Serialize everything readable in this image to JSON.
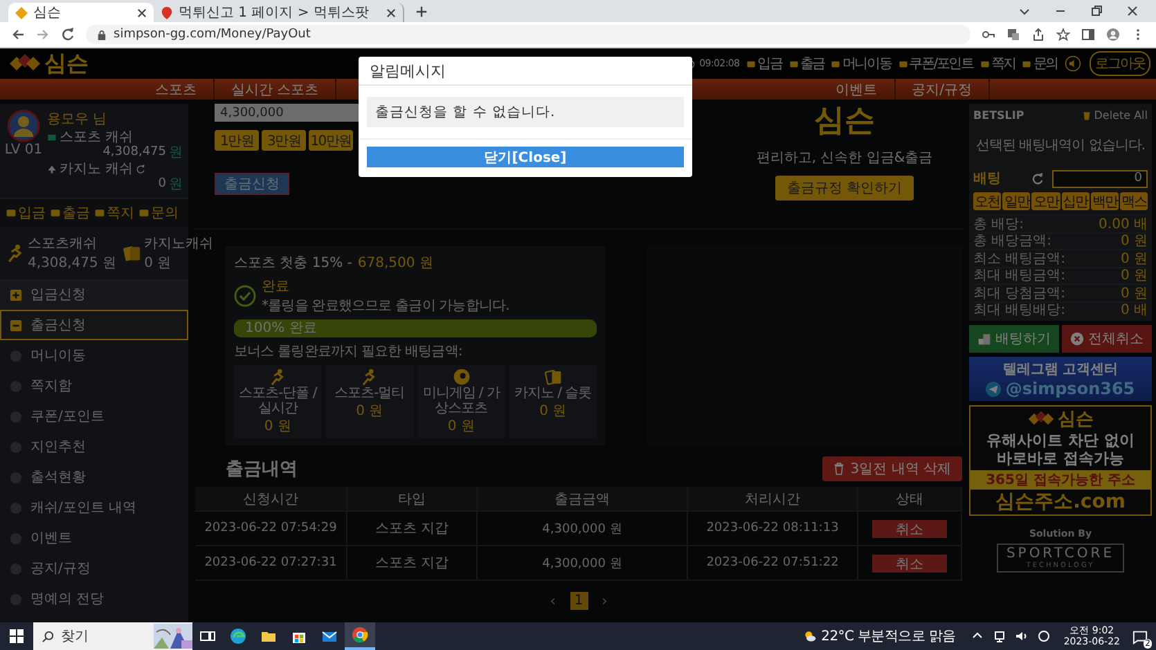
{
  "browser": {
    "tabs": [
      {
        "title": "심슨",
        "selected": true
      },
      {
        "title": "먹튀신고 1 페이지 > 먹튀스팟",
        "selected": false
      }
    ],
    "url": "simpson-gg.com/Money/PayOut"
  },
  "header": {
    "logo": "심슨",
    "clock": "09:02:08",
    "links": [
      "입금",
      "출금",
      "머니이동",
      "쿠폰/포인트",
      "쪽지",
      "문의"
    ],
    "logout": "로그아웃"
  },
  "nav": {
    "left": [
      "스포츠",
      "실시간 스포츠"
    ],
    "right": [
      "이벤트",
      "공지/규정"
    ]
  },
  "user": {
    "name": "용모우 님",
    "level": "LV 01",
    "wallets": [
      {
        "kind": "sports",
        "label": "스포츠 캐쉬",
        "amount": "4,308,475",
        "unit": "원"
      },
      {
        "kind": "casino",
        "label": "카지노 캐쉬",
        "amount": "0",
        "unit": "원"
      }
    ],
    "quick_links": [
      "입금",
      "출금",
      "쪽지",
      "문의"
    ]
  },
  "cash_cards": [
    {
      "kind": "sports",
      "label": "스포츠캐쉬",
      "amount": "4,308,475 원"
    },
    {
      "kind": "casino",
      "label": "카지노캐쉬",
      "amount": "0 원"
    }
  ],
  "menu": [
    {
      "label": "입금신청",
      "kind": "plus",
      "selected": false
    },
    {
      "label": "출금신청",
      "kind": "minus",
      "selected": true
    },
    {
      "label": "머니이동",
      "kind": "dot",
      "selected": false
    },
    {
      "label": "쪽지함",
      "kind": "dot",
      "selected": false
    },
    {
      "label": "쿠폰/포인트",
      "kind": "dot",
      "selected": false
    },
    {
      "label": "지인추천",
      "kind": "dot",
      "selected": false
    },
    {
      "label": "출석현황",
      "kind": "dot",
      "selected": false
    },
    {
      "label": "캐쉬/포인트 내역",
      "kind": "dot",
      "selected": false
    },
    {
      "label": "이벤트",
      "kind": "dot",
      "selected": false
    },
    {
      "label": "공지/규정",
      "kind": "dot",
      "selected": false
    },
    {
      "label": "명예의 전당",
      "kind": "dot",
      "selected": false
    }
  ],
  "withdraw": {
    "amount": "4,300,000",
    "quick_amounts": [
      "1만원",
      "3만원",
      "10만원"
    ],
    "submit": "출금신청"
  },
  "info": {
    "logo": "심슨",
    "tagline": "편리하고, 신속한 입금&출금",
    "rules_button": "출금규정 확인하기"
  },
  "bonus": {
    "title": "스포츠 첫충 15% -",
    "amount": "678,500 원",
    "status": "완료",
    "note": "*롤링을 완료했으므로 출금이 가능합니다.",
    "progress": {
      "level": 1,
      "label": "100% 완료"
    },
    "requirement": "보너스 롤링완료까지 필요한 배팅금액:",
    "targets": [
      {
        "kind": "runner",
        "label": "스포츠-단폴 / 실시간",
        "amount": "0 원"
      },
      {
        "kind": "runner",
        "label": "스포츠-멀티",
        "amount": "0 원"
      },
      {
        "kind": "ball",
        "label": "미니게임 / 가상스포츠",
        "amount": "0 원"
      },
      {
        "kind": "cards",
        "label": "카지노 / 슬롯",
        "amount": "0 원"
      }
    ]
  },
  "history": {
    "title": "출금내역",
    "delete_button": "3일전 내역 삭제",
    "columns": [
      "신청시간",
      "타입",
      "출금금액",
      "처리시간",
      "상태"
    ],
    "rows": [
      {
        "requested": "2023-06-22 07:54:29",
        "type": "스포츠 지갑",
        "amount": "4,300,000 원",
        "processed": "2023-06-22 08:11:13",
        "status": "취소"
      },
      {
        "requested": "2023-06-22 07:27:31",
        "type": "스포츠 지갑",
        "amount": "4,300,000 원",
        "processed": "2023-06-22 07:51:22",
        "status": "취소"
      }
    ]
  },
  "pagination": {
    "prev": "‹",
    "next": "›",
    "pages": [
      {
        "label": "1",
        "selected": true
      }
    ]
  },
  "modal": {
    "title": "알림메시지",
    "message": "출금신청을 할 수 없습니다.",
    "button": "닫기[Close]"
  },
  "betslip": {
    "title": "BETSLIP",
    "delete_all": "Delete All",
    "empty": "선택된 배팅내역이 없습니다.",
    "stake_label": "배팅",
    "stake": "0",
    "chips": [
      "오천",
      "일만",
      "오만",
      "십만",
      "백만",
      "맥스"
    ],
    "summary": [
      {
        "label": "총 배당:",
        "value": "0.00 배"
      },
      {
        "label": "총 배당금액:",
        "value": "0 원"
      },
      {
        "label": "최소 배팅금액:",
        "value": "0 원"
      },
      {
        "label": "최대 배팅금액:",
        "value": "0 원"
      },
      {
        "label": "최대 당첨금액:",
        "value": "0 원"
      },
      {
        "label": "최대 배팅배당:",
        "value": "0 배"
      }
    ],
    "bet_button": "배팅하기",
    "cancel_button": "전체취소"
  },
  "banners": {
    "telegram": {
      "title": "텔레그램 고객센터",
      "handle": "@simpson365"
    },
    "ad": {
      "logo": "심슨",
      "lines": [
        "유해사이트 차단 없이",
        "바로바로 접속가능"
      ],
      "strip": "365일 접속가능한 주소",
      "domain": "심슨주소.com"
    },
    "solution": {
      "label": "Solution By",
      "brand": "SPORTCORE",
      "sub": "TECHNOLOGY"
    }
  },
  "taskbar": {
    "search": "찾기",
    "apps": [
      {
        "kind": "taskview",
        "selected": false
      },
      {
        "kind": "edge",
        "selected": false
      },
      {
        "kind": "explorer",
        "selected": false
      },
      {
        "kind": "store",
        "selected": false
      },
      {
        "kind": "mail",
        "selected": false
      },
      {
        "kind": "chrome",
        "selected": true
      }
    ],
    "weather": "22°C 부분적으로 맑음",
    "time": "오전 9:02",
    "date": "2023-06-22",
    "notifications": "2"
  }
}
